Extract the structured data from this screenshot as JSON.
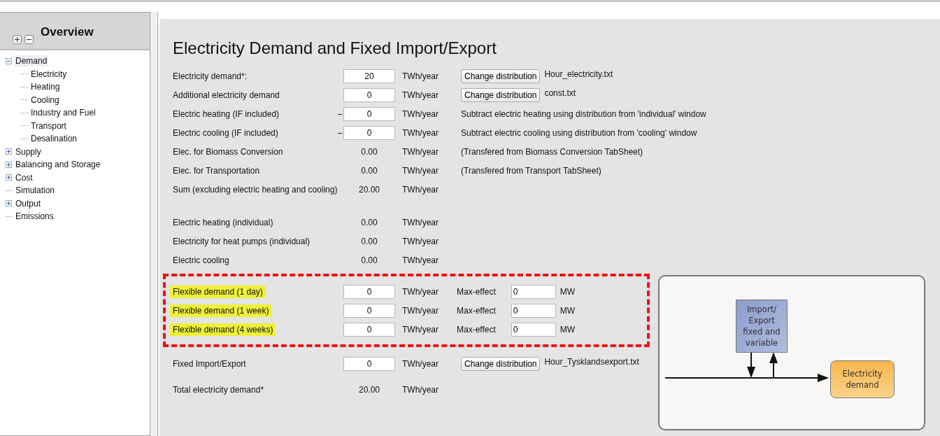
{
  "sidebar": {
    "title": "Overview",
    "tree": [
      {
        "label": "Demand",
        "kind": "folder",
        "expanded": true,
        "selected": true,
        "children": [
          {
            "label": "Electricity",
            "kind": "leaf",
            "selected": false
          },
          {
            "label": "Heating",
            "kind": "leaf",
            "selected": false
          },
          {
            "label": "Cooling",
            "kind": "leaf",
            "selected": false
          },
          {
            "label": "Industry and Fuel",
            "kind": "leaf",
            "selected": false
          },
          {
            "label": "Transport",
            "kind": "leaf",
            "selected": false
          },
          {
            "label": "Desalination",
            "kind": "leaf",
            "selected": false
          }
        ]
      },
      {
        "label": "Supply",
        "kind": "folder",
        "expanded": false,
        "selected": false
      },
      {
        "label": "Balancing and Storage",
        "kind": "folder",
        "expanded": false,
        "selected": false
      },
      {
        "label": "Cost",
        "kind": "folder",
        "expanded": false,
        "selected": false
      },
      {
        "label": "Simulation",
        "kind": "leaf",
        "selected": false
      },
      {
        "label": "Output",
        "kind": "folder",
        "expanded": false,
        "selected": false
      },
      {
        "label": "Emissions",
        "kind": "leaf",
        "selected": false
      }
    ]
  },
  "main": {
    "title": "Electricity Demand and Fixed Import/Export",
    "sections": [
      {
        "framed": false,
        "rows": [
          {
            "label": "Electricity demand*:",
            "kind": "input",
            "value": "20",
            "unit": "TWh/year",
            "button": "Change distribution",
            "file": "Hour_electricity.txt"
          },
          {
            "label": "Additional electricity demand",
            "kind": "input",
            "value": "0",
            "unit": "TWh/year",
            "button": "Change distribution",
            "file": "const.txt"
          },
          {
            "label": "Electric heating (IF included)",
            "kind": "input",
            "sign": "–",
            "value": "0",
            "unit": "TWh/year",
            "note": "Subtract electric heating using distribution from 'individual' window"
          },
          {
            "label": "Electric cooling (IF included)",
            "kind": "input",
            "sign": "–",
            "value": "0",
            "unit": "TWh/year",
            "note": "Subtract electric cooling using distribution from 'cooling' window"
          },
          {
            "label": "Elec. for Biomass Conversion",
            "kind": "value",
            "value": "0.00",
            "unit": "TWh/year",
            "note": "(Transfered from Biomass Conversion TabSheet)"
          },
          {
            "label": "Elec. for Transportation",
            "kind": "value",
            "value": "0.00",
            "unit": "TWh/year",
            "note": "(Transfered from Transport TabSheet)"
          },
          {
            "label": "Sum (excluding electric heating and cooling)",
            "kind": "value",
            "value": "20.00",
            "unit": "TWh/year"
          }
        ]
      },
      {
        "framed": false,
        "rows": [
          {
            "label": "Electric heating (individual)",
            "kind": "value",
            "value": "0.00",
            "unit": "TWh/year"
          },
          {
            "label": "Electricity for heat pumps (individual)",
            "kind": "value",
            "value": "0.00",
            "unit": "TWh/year"
          },
          {
            "label": "Electric cooling",
            "kind": "value",
            "value": "0.00",
            "unit": "TWh/year"
          }
        ]
      },
      {
        "framed": true,
        "rows": [
          {
            "label": "Flexible demand (1 day)",
            "highlighted": true,
            "kind": "input",
            "value": "0",
            "unit": "TWh/year",
            "max_label": "Max-effect",
            "max_value": "0",
            "max_unit": "MW"
          },
          {
            "label": "Flexible demand (1 week)",
            "highlighted": true,
            "kind": "input",
            "value": "0",
            "unit": "TWh/year",
            "max_label": "Max-effect",
            "max_value": "0",
            "max_unit": "MW"
          },
          {
            "label": "Flexible demand (4 weeks)",
            "highlighted": true,
            "kind": "input",
            "value": "0",
            "unit": "TWh/year",
            "max_label": "Max-effect",
            "max_value": "0",
            "max_unit": "MW"
          }
        ]
      },
      {
        "framed": false,
        "rows": [
          {
            "label": "Fixed Import/Export",
            "kind": "input",
            "value": "0",
            "unit": "TWh/year",
            "button": "Change distribution",
            "file": "Hour_Tysklandsexport.txt"
          }
        ]
      },
      {
        "framed": false,
        "rows": [
          {
            "label": "Total electricity demand*",
            "kind": "value",
            "value": "20.00",
            "unit": "TWh/year"
          }
        ]
      }
    ],
    "diagram": {
      "source": [
        "Import/",
        "Export",
        "fixed and",
        "variable"
      ],
      "target": [
        "Electricity",
        "demand"
      ]
    }
  }
}
